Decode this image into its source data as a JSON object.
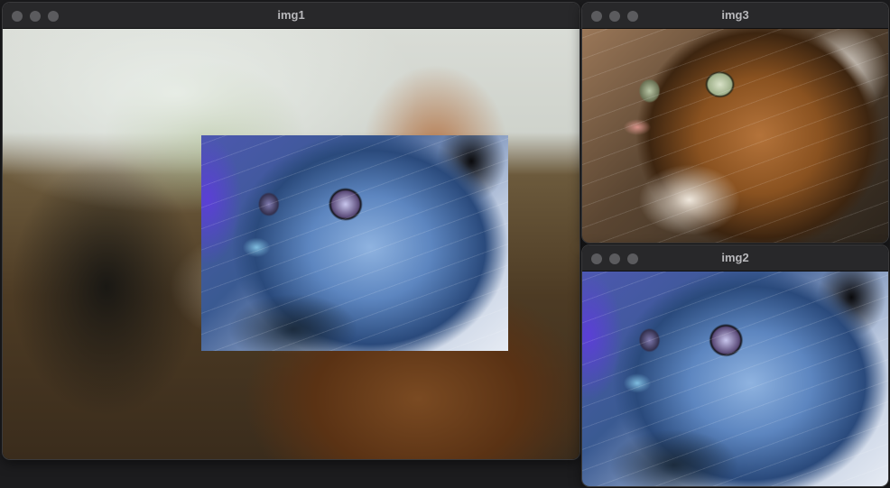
{
  "windows": [
    {
      "id": "img1",
      "title": "img1"
    },
    {
      "id": "img3",
      "title": "img3"
    },
    {
      "id": "img2",
      "title": "img2"
    }
  ]
}
